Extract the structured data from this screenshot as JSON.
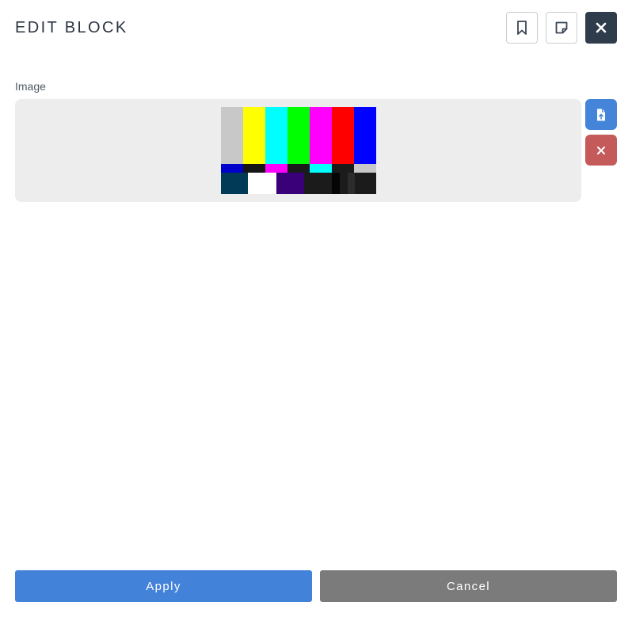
{
  "header": {
    "title": "EDIT BLOCK",
    "icons": [
      "bookmark-icon",
      "note-icon",
      "close-icon"
    ]
  },
  "image_field": {
    "label": "Image",
    "preview_icon": "color-bars-test-pattern",
    "actions": [
      "upload-file-icon",
      "remove-icon"
    ]
  },
  "footer": {
    "apply_label": "Apply",
    "cancel_label": "Cancel"
  },
  "colors": {
    "primary": "#4282d8",
    "danger": "#c45a5a",
    "dark": "#2f3c4b",
    "muted": "#7b7b7b",
    "well": "#ededed"
  }
}
